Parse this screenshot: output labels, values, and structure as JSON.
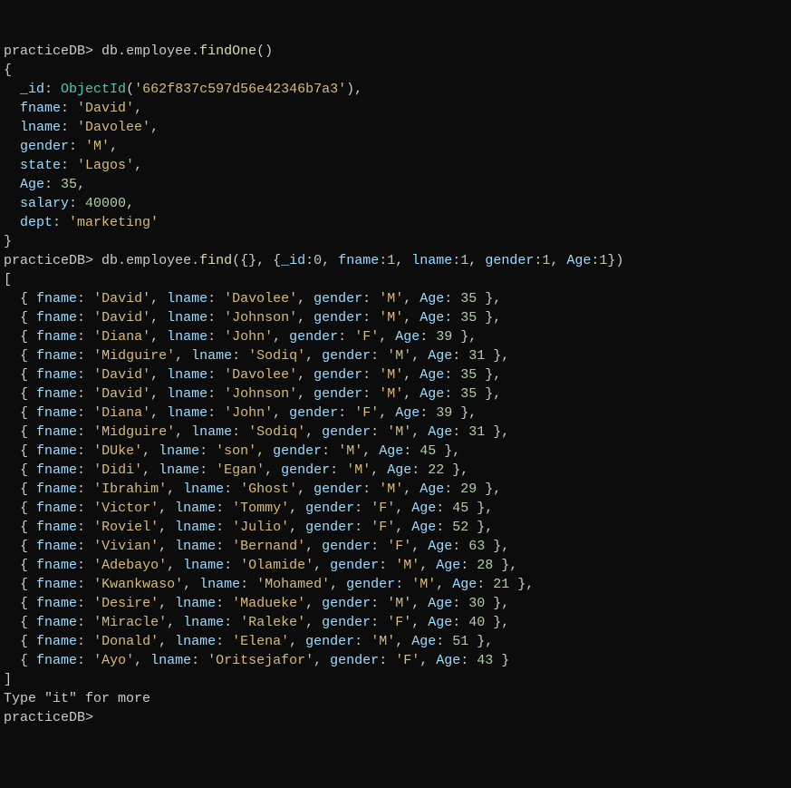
{
  "prompt": "practiceDB>",
  "command1": "db.employee.findOne()",
  "findOneResult": {
    "_id": "662f837c597d56e42346b7a3",
    "fname": "David",
    "lname": "Davolee",
    "gender": "M",
    "state": "Lagos",
    "Age": 35,
    "salary": 40000,
    "dept": "marketing"
  },
  "command2": "db.employee.find({}, {_id:0, fname:1, lname:1, gender:1, Age:1})",
  "findResults": [
    {
      "fname": "David",
      "lname": "Davolee",
      "gender": "M",
      "Age": 35
    },
    {
      "fname": "David",
      "lname": "Johnson",
      "gender": "M",
      "Age": 35
    },
    {
      "fname": "Diana",
      "lname": "John",
      "gender": "F",
      "Age": 39
    },
    {
      "fname": "Midguire",
      "lname": "Sodiq",
      "gender": "M",
      "Age": 31
    },
    {
      "fname": "David",
      "lname": "Davolee",
      "gender": "M",
      "Age": 35
    },
    {
      "fname": "David",
      "lname": "Johnson",
      "gender": "M",
      "Age": 35
    },
    {
      "fname": "Diana",
      "lname": "John",
      "gender": "F",
      "Age": 39
    },
    {
      "fname": "Midguire",
      "lname": "Sodiq",
      "gender": "M",
      "Age": 31
    },
    {
      "fname": "DUke",
      "lname": "son",
      "gender": "M",
      "Age": 45
    },
    {
      "fname": "Didi",
      "lname": "Egan",
      "gender": "M",
      "Age": 22
    },
    {
      "fname": "Ibrahim",
      "lname": "Ghost",
      "gender": "M",
      "Age": 29
    },
    {
      "fname": "Victor",
      "lname": "Tommy",
      "gender": "F",
      "Age": 45
    },
    {
      "fname": "Roviel",
      "lname": "Julio",
      "gender": "F",
      "Age": 52
    },
    {
      "fname": "Vivian",
      "lname": "Bernand",
      "gender": "F",
      "Age": 63
    },
    {
      "fname": "Adebayo",
      "lname": "Olamide",
      "gender": "M",
      "Age": 28
    },
    {
      "fname": "Kwankwaso",
      "lname": "Mohamed",
      "gender": "M",
      "Age": 21
    },
    {
      "fname": "Desire",
      "lname": "Madueke",
      "gender": "M",
      "Age": 30
    },
    {
      "fname": "Miracle",
      "lname": "Raleke",
      "gender": "F",
      "Age": 40
    },
    {
      "fname": "Donald",
      "lname": "Elena",
      "gender": "M",
      "Age": 51
    },
    {
      "fname": "Ayo",
      "lname": "Oritsejafor",
      "gender": "F",
      "Age": 43
    }
  ],
  "itMessage": "Type \"it\" for more"
}
